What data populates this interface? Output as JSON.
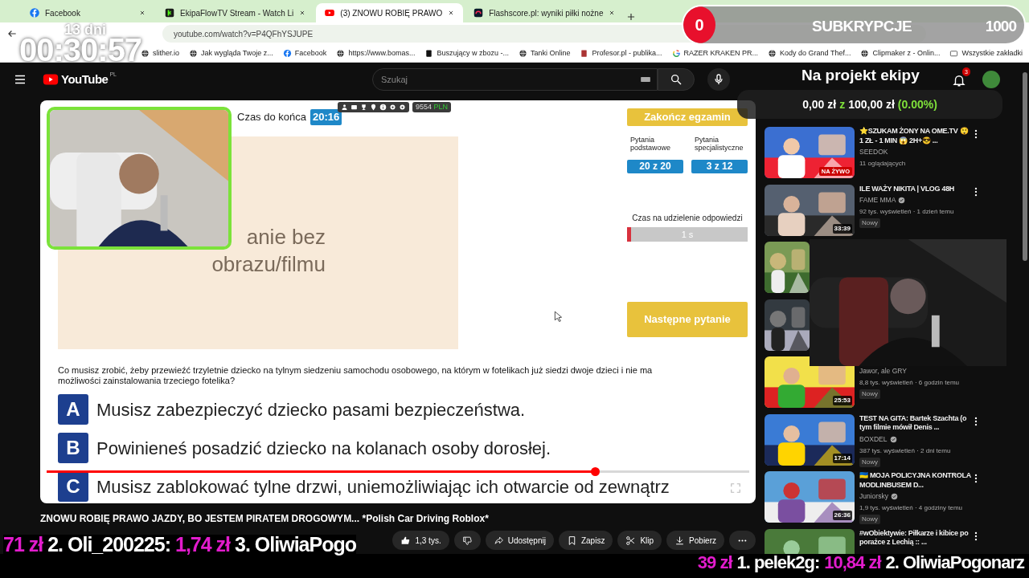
{
  "browser": {
    "tabs": [
      {
        "title": "Facebook",
        "kind": "facebook",
        "selected": false
      },
      {
        "title": "EkipaFlowTV Stream - Watch Li",
        "kind": "kick",
        "selected": false
      },
      {
        "title": "(3) ZNOWU ROBIĘ PRAWO",
        "kind": "youtube",
        "selected": true
      },
      {
        "title": "Flashscore.pl: wyniki piłki nożne",
        "kind": "flashscore",
        "selected": false
      }
    ],
    "address": "youtube.com/watch?v=P4QFhYSJUPE",
    "bookmarks": [
      {
        "label": "slither.io",
        "kind": "globe"
      },
      {
        "label": "Jak wygląda Twoje z...",
        "kind": "globe"
      },
      {
        "label": "Facebook",
        "kind": "facebook"
      },
      {
        "label": "https://www.bomas...",
        "kind": "globe"
      },
      {
        "label": "Buszujący w zbozu -...",
        "kind": "square"
      },
      {
        "label": "Tanki Online",
        "kind": "globe"
      },
      {
        "label": "Profesor.pl - publika...",
        "kind": "page"
      },
      {
        "label": "RAZER KRAKEN PR...",
        "kind": "google"
      },
      {
        "label": "Kody do Grand Thef...",
        "kind": "globe"
      },
      {
        "label": "Clipmaker z - Onlin...",
        "kind": "globe"
      },
      {
        "label": "Wszystkie zakładki",
        "kind": "folder"
      }
    ]
  },
  "overlay": {
    "days": "13 dni",
    "timer": "00:30:57",
    "subs": {
      "count": "0",
      "label": "SUBKRYPCJE",
      "goal": "1000",
      "level": 0
    },
    "goal": {
      "title": "Na projekt ekipy",
      "amount": "0,00 zł",
      "sep": "z",
      "target": "100,00 zł",
      "percent": "(0.00%)"
    },
    "ticker_left": [
      {
        "kind": "amount",
        "text": "71 zł"
      },
      {
        "kind": "name",
        "text": "2. Oli_200225:"
      },
      {
        "kind": "amount",
        "text": "1,74 zł"
      },
      {
        "kind": "name",
        "text": "3. OliwiaPogo"
      }
    ],
    "ticker_right": [
      {
        "kind": "amount",
        "text": "39 zł"
      },
      {
        "kind": "name",
        "text": "1. pelek2g:"
      },
      {
        "kind": "amount",
        "text": "10,84 zł"
      },
      {
        "kind": "name",
        "text": "2. OliwiaPogonarz"
      }
    ]
  },
  "youtube": {
    "logo": "YouTube",
    "region": "PL",
    "search_placeholder": "Szukaj",
    "notifications": "3"
  },
  "exam": {
    "time_label": "Czas do końca",
    "time": "20:16",
    "balance": "9554",
    "currency": "PLN",
    "no_media": [
      "anie bez",
      "obrazu/filmu"
    ],
    "finish": "Zakończ egzamin",
    "counters": [
      {
        "label": "Pytania podstawowe",
        "value": "20 z 20"
      },
      {
        "label": "Pytania specjalistyczne",
        "value": "3 z 12"
      }
    ],
    "answer_timer": {
      "label": "Czas na udzielenie odpowiedzi",
      "value": "1 s",
      "level": 0.03
    },
    "next": "Następne pytanie",
    "question": "Co musisz zrobić, żeby przewieźć trzyletnie dziecko na tylnym siedzeniu samochodu osobowego, na którym w fotelikach już siedzi dwoje dzieci i nie ma możliwości zainstalowania trzeciego fotelika?",
    "answers": [
      {
        "letter": "A",
        "text": "Musisz zabezpieczyć dziecko pasami bezpieczeństwa."
      },
      {
        "letter": "B",
        "text": "Powinieneś posadzić dziecko na kolanach osoby dorosłej."
      },
      {
        "letter": "C",
        "text": "Musisz zablokować tylne drzwi, uniemożliwiając ich otwarcie od zewnątrz"
      }
    ]
  },
  "player": {
    "level": 0.78
  },
  "video": {
    "title": "ZNOWU ROBIĘ PRAWO JAZDY, BO JESTEM PIRATEM DROGOWYM... *Polish Car Driving Roblox*",
    "actions": [
      {
        "kind": "like",
        "label": "1,3 tys."
      },
      {
        "kind": "dislike"
      },
      {
        "kind": "share",
        "label": "Udostępnij"
      },
      {
        "kind": "save",
        "label": "Zapisz"
      },
      {
        "kind": "clip",
        "label": "Klip"
      },
      {
        "kind": "download",
        "label": "Pobierz"
      },
      {
        "kind": "more"
      }
    ]
  },
  "sidebar": [
    {
      "thumbnail": {
        "kind": "picture"
      },
      "title": "⭐SZUKAM ŻONY NA OME.TV 😲 1 ZŁ - 1 MIN 😱 2H+😎 ...",
      "channel": "SEEDOK",
      "verified": false,
      "meta": "11 oglądających",
      "live": "NA ŻYWO"
    },
    {
      "thumbnail": {
        "kind": "picture"
      },
      "title": "ILE WAŻY NIKITA | VLOG 48H",
      "channel": "FAME MMA",
      "verified": true,
      "meta": "92 tys. wyświetleń · 1 dzień temu",
      "badge": "Nowy",
      "duration": "33:39"
    },
    {
      "thumbnail": {
        "kind": "picture"
      }
    },
    {
      "thumbnail": {
        "kind": "picture"
      }
    },
    {
      "thumbnail": {
        "kind": "picture"
      },
      "channel": "Jawor, ale GRY",
      "verified": false,
      "meta": "8,8 tys. wyświetleń · 6 godzin temu",
      "badge": "Nowy",
      "duration": "25:53"
    },
    {
      "thumbnail": {
        "kind": "picture"
      },
      "title": "TEST NA GITA: Bartek Szachta (o tym filmie mówił Denis ...",
      "channel": "BOXDEL",
      "verified": true,
      "meta": "387 tys. wyświetleń · 2 dni temu",
      "badge": "Nowy",
      "duration": "17:14"
    },
    {
      "thumbnail": {
        "kind": "picture"
      },
      "title": "🇺🇦 MOJA POLICYJNA KONTROLA MODLINBUSEM D...",
      "channel": "Juniorsky",
      "verified": true,
      "meta": "1,9 tys. wyświetleń · 4 godziny temu",
      "badge": "Nowy",
      "duration": "26:36"
    },
    {
      "thumbnail": {
        "kind": "picture"
      },
      "title": "#wObiektywie: Piłkarze i kibice po porażce z Lechią :: ..."
    }
  ]
}
